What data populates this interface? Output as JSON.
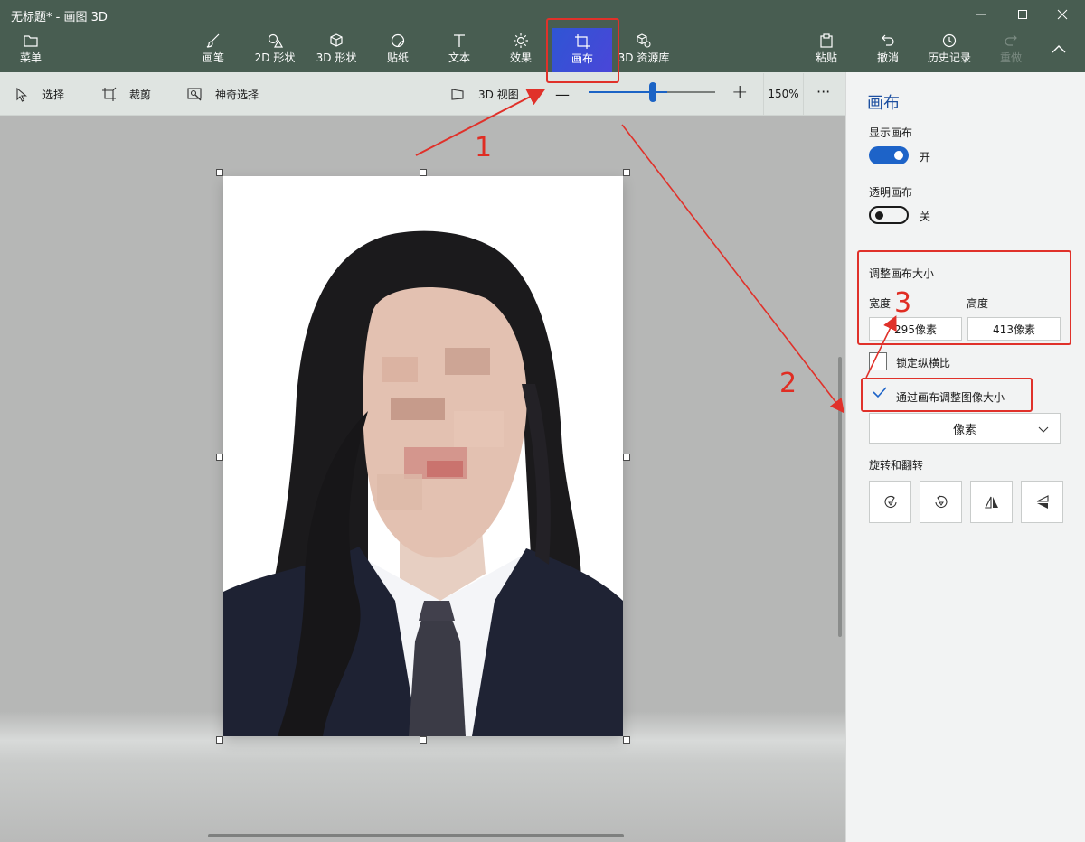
{
  "window": {
    "title": "无标题* - 画图 3D",
    "controls": [
      "minimize-icon",
      "maximize-icon",
      "close-icon"
    ]
  },
  "ribbon": {
    "menu_label": "菜单",
    "tools": [
      {
        "label": "画笔",
        "icon": "brush-icon"
      },
      {
        "label": "2D 形状",
        "icon": "shapes-2d-icon"
      },
      {
        "label": "3D 形状",
        "icon": "cube-icon"
      },
      {
        "label": "贴纸",
        "icon": "sticker-icon"
      },
      {
        "label": "文本",
        "icon": "text-icon"
      },
      {
        "label": "效果",
        "icon": "effects-icon"
      },
      {
        "label": "画布",
        "icon": "canvas-icon",
        "active": true
      },
      {
        "label": "3D 资源库",
        "icon": "library-3d-icon"
      }
    ],
    "right_tools": [
      {
        "label": "粘贴",
        "icon": "paste-icon"
      },
      {
        "label": "撤消",
        "icon": "undo-icon"
      },
      {
        "label": "历史记录",
        "icon": "history-icon"
      },
      {
        "label": "重做",
        "icon": "redo-icon",
        "disabled": true
      }
    ],
    "collapse_icon": "chevron-up-icon"
  },
  "toolbar": {
    "select_label": "选择",
    "crop_label": "裁剪",
    "magic_select_label": "神奇选择",
    "view3d_label": "3D 视图",
    "zoom_out": "—",
    "zoom_in": "+",
    "zoom_percent": 62,
    "zoom_label": "150%",
    "more": "···"
  },
  "panel": {
    "title": "画布",
    "show_canvas_label": "显示画布",
    "show_canvas_state": "开",
    "transparent_canvas_label": "透明画布",
    "transparent_canvas_state": "关",
    "resize_label": "调整画布大小",
    "width_label": "宽度",
    "height_label": "高度",
    "width_value": "295像素",
    "height_value": "413像素",
    "lock_ratio_label": "锁定纵横比",
    "resize_image_label": "通过画布调整图像大小",
    "units_value": "像素",
    "rotate_label": "旋转和翻转"
  },
  "annotations": {
    "step1": "1",
    "step2": "2",
    "step3": "3",
    "color": "#e0312a"
  },
  "colors": {
    "ribbon": "#485d51",
    "accent": "#1d63c8",
    "active_tool": "#3a50d6"
  }
}
